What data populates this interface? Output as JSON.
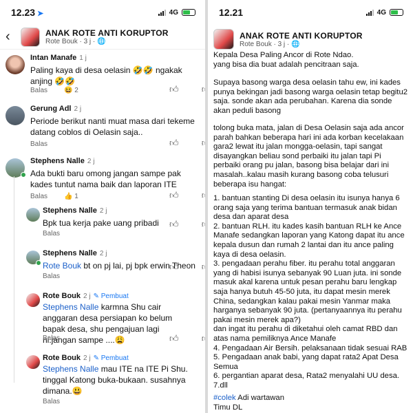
{
  "left_status": {
    "time": "12.23",
    "network": "4G",
    "location_icon": "location-arrow-icon"
  },
  "right_status": {
    "time": "12.21",
    "network": "4G"
  },
  "header": {
    "group_name": "ANAK ROTE ANTI KORUPTOR",
    "sub": "Rote Bouk · 3 j · ",
    "globe_icon": "globe-icon"
  },
  "comments": [
    {
      "name": "Intan Manafe",
      "time": "1 j",
      "text": "Paling kaya di desa oelasin 🤣🤣 ngakak anjing 🤣🤣",
      "reply": "Balas",
      "reactions": "😆",
      "reaction_count": "2"
    },
    {
      "name": "Gerung Adl",
      "time": "2 j",
      "text": "Periode berikut nanti muat masa dari tekeme datang coblos di Oelasin saja..",
      "reply": "Balas"
    },
    {
      "name": "Stephens Nalle",
      "time": "2 j",
      "text": "Ada bukti baru omong jangan sampe pak kades tuntut nama baik dan laporan ITE",
      "reply": "Balas",
      "reactions": "👍",
      "reaction_count": "1"
    },
    {
      "name": "Stephens Nalle",
      "time": "2 j",
      "text": "Bpk tua kerja pake uang pribadi",
      "reply": "Balas"
    },
    {
      "name": "Stephens Nalle",
      "time": "2 j",
      "mention": "Rote Bouk",
      "text": " bt on pj lai, pj bpk erwin Theon",
      "reply": "Balas"
    },
    {
      "name": "Rote Bouk",
      "time": "2 j",
      "creator": "✎ Pembuat",
      "mention": "Stephens Nalle",
      "text": " karmna Shu cair anggaran desa persiapan ko belum bapak desa, shu pengajuan lagi ni.jangan sampe ....😩",
      "reply": "Balas"
    },
    {
      "name": "Rote Bouk",
      "time": "2 j",
      "creator": "✎ Pembuat",
      "mention": "Stephens Nalle",
      "text": " mau ITE na ITE Pi Shu. tinggal Katong buka-bukaan. susahnya dimana.😃",
      "reply": "Balas"
    }
  ],
  "post": {
    "line1": "Kepala Desa Paling Ancor di Rote Ndao.",
    "line2": "yang bisa dia buat adalah pencitraan saja.",
    "para2": "Supaya basong warga desa oelasin tahu ew, ini kades punya bekingan jadi basong warga oelasin tetap begitu2 saja. sonde akan ada perubahan. Karena dia sonde akan peduli basong",
    "para3": "tolong buka mata, jalan di Desa Oelasin saja ada ancor parah bahkan beberapa hari ini ada korban kecelakaan gara2 lewat itu jalan mongga-oelasin, tapi sangat disayangkan beliau sond perbaiki itu jalan tapi Pi perbaiki orang pu jalan, basong bisa belajar dari ini masalah..kalau masih kurang basong coba telusuri beberapa isu hangat:",
    "list": "1. bantuan stanting Di desa oelasin itu isunya hanya 6 orang saja yang terima bantuan termasuk anak bidan desa dan aparat desa\n2. bantuan RLH. itu kades kasih bantuan RLH ke Ance Manafe sedangkan laporan yang Katong dapat itu ance kepala dusun dan rumah 2 lantai dan itu ance paling kaya di desa oelasin.\n3. pengadaan perahu fiber. itu perahu total anggaran yang di habisi isunya sebanyak 90 Luan juta. ini sonde masuk akal karena untuk pesan perahu baru lengkap saja hanya butuh 45-50 juta, itu dapat mesin merek China, sedangkan kalau pakai mesin Yanmar maka harganya sebanyak 90 juta. (pertanyaannya itu perahu pakai mesin merek apa?)\ndan ingat itu perahu di diketahui oleh camat RBD dan atas nama pemiliknya Ance Manafe\n4. Pengadaan Air Bersih. pelaksanaan tidak sesuai RAB\n5. Pengadaan anak babi, yang dapat rata2 Apat Desa Semua\n6. pergantian aparat desa, Rata2 menyalahi UU desa.\n7.dll",
    "hashtag": "#colek",
    "hashtag_rest": " Adi wartawan",
    "sign": "Timu DL"
  }
}
